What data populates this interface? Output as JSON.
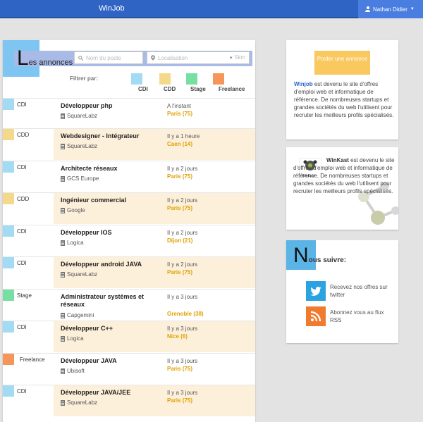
{
  "app": {
    "brand": "WinJob",
    "user": "Nathan Didier"
  },
  "listing": {
    "title_cap": "L",
    "title_rest": "es annonces",
    "search_placeholder": "Nom du poste",
    "location_placeholder": "Localisation",
    "radius": "5km",
    "filter_label": "Filtrer par:",
    "filters": [
      {
        "label": "CDI",
        "color": "#a3dbf5"
      },
      {
        "label": "CDD",
        "color": "#f5d98a"
      },
      {
        "label": "Stage",
        "color": "#76e0a4"
      },
      {
        "label": "Freelance",
        "color": "#f5955a"
      }
    ],
    "jobs": [
      {
        "type": "CDI",
        "type_color": "#a3dbf5",
        "title": "Développeur php",
        "company": "SquareLabz",
        "posted": "A l'instant",
        "city": "Paris (75)",
        "highlight": false
      },
      {
        "type": "CDD",
        "type_color": "#f5d98a",
        "title": "Webdesigner - Intégrateur",
        "company": "SquareLabz",
        "posted": "Il y a 1 heure",
        "city": "Caen (14)",
        "highlight": true
      },
      {
        "type": "CDI",
        "type_color": "#a3dbf5",
        "title": "Architecte réseaux",
        "company": "GCS Europe",
        "posted": "Il y a 2 jours",
        "city": "Paris (75)",
        "highlight": false
      },
      {
        "type": "CDD",
        "type_color": "#f5d98a",
        "title": "Ingénieur commercial",
        "company": "Google",
        "posted": "Il y a 2 jours",
        "city": "Paris (75)",
        "highlight": true
      },
      {
        "type": "CDI",
        "type_color": "#a3dbf5",
        "title": "Développeur IOS",
        "company": "Logica",
        "posted": "Il y a 2 jours",
        "city": "Dijon (21)",
        "highlight": false
      },
      {
        "type": "CDI",
        "type_color": "#a3dbf5",
        "title": "Développeur android JAVA",
        "company": "SquareLabz",
        "posted": "Il y a 2 jours",
        "city": "Paris (75)",
        "highlight": true
      },
      {
        "type": "Stage",
        "type_color": "#76e0a4",
        "title": "Administrateur systèmes et réseaux",
        "company": "Capgemini",
        "posted": "Il y a 3 jours",
        "city": "Grenoble (38)",
        "highlight": false
      },
      {
        "type": "CDI",
        "type_color": "#a3dbf5",
        "title": "Développeur C++",
        "company": "Logica",
        "posted": "Il y a 3 jours",
        "city": "Nice (6)",
        "highlight": true
      },
      {
        "type": "Freelance",
        "type_color": "#f5955a",
        "title": "Développeur JAVA",
        "company": "Ubisoft",
        "posted": "Il y a 3 jours",
        "city": "Paris (75)",
        "highlight": false
      },
      {
        "type": "CDI",
        "type_color": "#a3dbf5",
        "title": "Développeur JAVA/JEE",
        "company": "SquareLabz",
        "posted": "Il y a 3 jours",
        "city": "Paris (75)",
        "highlight": true
      }
    ]
  },
  "sidebar": {
    "post_button": "Poster une annonce",
    "about_brand": "Winjob",
    "about_text": " est devenu le site d'offres d'emploi web et informatique de référence. De nombreuses startups et grandes sociétés du web l'utilisent pour recruter les meilleurs profils spécialisés.",
    "winkast_brand": "WinKast",
    "winkast_text": " est devenu le site d'offres d'emploi web et informatique de référence. De nombreuses startups et grandes sociétés du web l'utilisent pour recruter les meilleurs profils spécialisés.",
    "winkast_logo_text": "WinKast",
    "follow_cap": "N",
    "follow_rest": "ous suivre:",
    "twitter_label": "Recevez nos offres sur twitter",
    "rss_label": "Abonnez vous au flux RSS"
  },
  "colors": {
    "accent": "#2f63c4",
    "highlight_row": "#fdf0da",
    "city": "#e0a000"
  }
}
